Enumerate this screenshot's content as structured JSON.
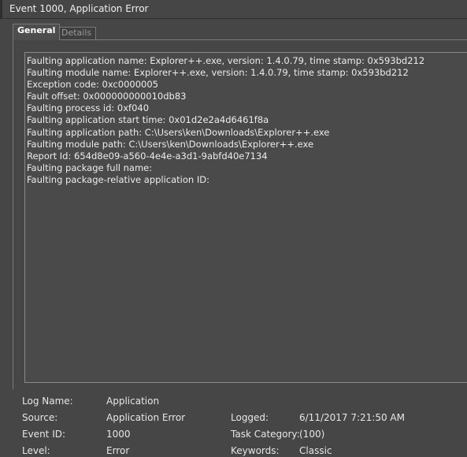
{
  "window": {
    "title": "Event 1000, Application Error"
  },
  "tabs": [
    {
      "label": "General",
      "active": true
    },
    {
      "label": "Details",
      "active": false
    }
  ],
  "description": {
    "lines": [
      "Faulting application name: Explorer++.exe, version: 1.4.0.79, time stamp: 0x593bd212",
      "Faulting module name: Explorer++.exe, version: 1.4.0.79, time stamp: 0x593bd212",
      "Exception code: 0xc0000005",
      "Fault offset: 0x000000000010db83",
      "Faulting process id: 0xf040",
      "Faulting application start time: 0x01d2e2a4d6461f8a",
      "Faulting application path: C:\\Users\\ken\\Downloads\\Explorer++.exe",
      "Faulting module path: C:\\Users\\ken\\Downloads\\Explorer++.exe",
      "Report Id: 654d8e09-a560-4e4e-a3d1-9abfd40e7134",
      "Faulting package full name: ",
      "Faulting package-relative application ID: "
    ]
  },
  "details": {
    "log_name": {
      "label": "Log Name:",
      "value": "Application"
    },
    "source": {
      "label": "Source:",
      "value": "Application Error"
    },
    "logged": {
      "label": "Logged:",
      "value": "6/11/2017 7:21:50 AM"
    },
    "event_id": {
      "label": "Event ID:",
      "value": "1000"
    },
    "task_category": {
      "label": "Task Category:",
      "value": "(100)"
    },
    "level": {
      "label": "Level:",
      "value": "Error"
    },
    "keywords": {
      "label": "Keywords:",
      "value": "Classic"
    }
  },
  "colors": {
    "background": "#464646",
    "text": "#e8e8e8",
    "border": "#7a7a7a"
  }
}
